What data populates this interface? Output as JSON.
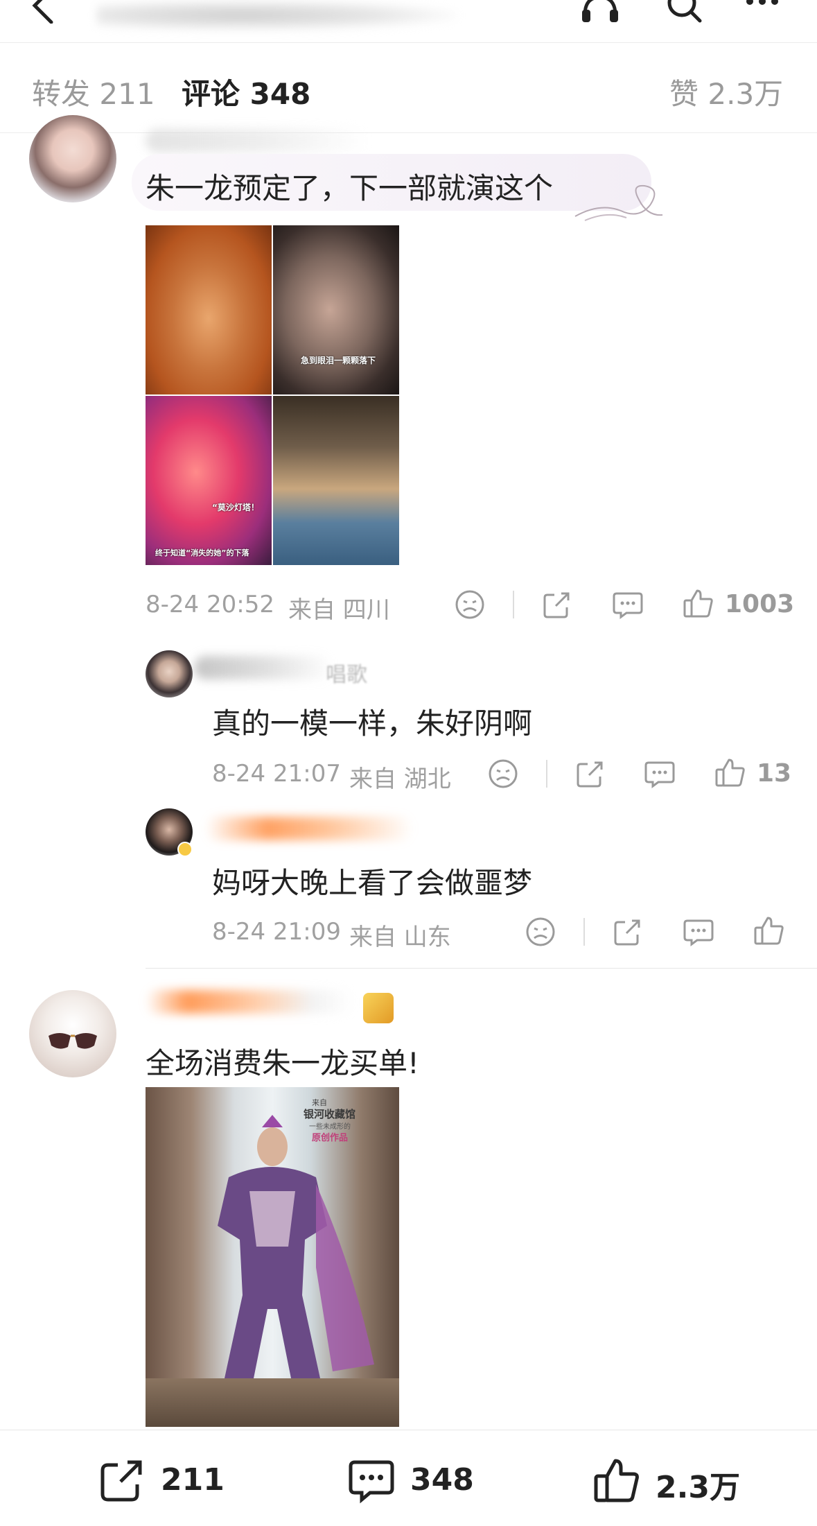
{
  "tabs": {
    "repost_label": "转发",
    "repost_count": "211",
    "comment_label": "评论",
    "comment_count": "348",
    "like_label": "赞",
    "like_count": "2.3万"
  },
  "comments": [
    {
      "text": "朱一龙预定了，下一部就演这个",
      "image_captions": [
        "急到眼泪一颗颗落下",
        "“莫沙灯塔！",
        "终于知道“消失的她”的下落"
      ],
      "time": "8-24 20:52",
      "location": "来自 四川",
      "like_count": "1003",
      "replies": [
        {
          "name_fragment": "唱歌",
          "text": "真的一模一样，朱好阴啊",
          "time": "8-24 21:07",
          "location": "来自 湖北",
          "like_count": "13"
        },
        {
          "text": "妈呀大晚上看了会做噩梦",
          "time": "8-24 21:09",
          "location": "来自 山东",
          "like_count": ""
        }
      ]
    },
    {
      "text": "全场消费朱一龙买单!",
      "poster_texts": [
        "来自",
        "银河收藏馆",
        "一些未成形的",
        "原创作品"
      ]
    }
  ],
  "bottom_bar": {
    "repost_count": "211",
    "comment_count": "348",
    "like_count": "2.3万"
  },
  "colors": {
    "text": "#222222",
    "muted": "#a0a0a0",
    "divider": "#e6e6e6",
    "blur_orange": "#ff8a3c"
  }
}
